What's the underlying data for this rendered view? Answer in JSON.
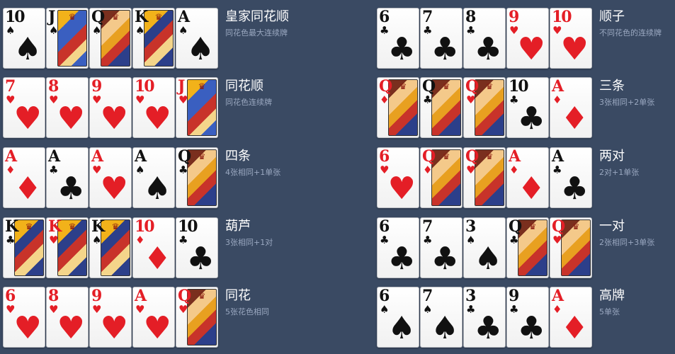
{
  "left": [
    {
      "title": "皇家同花顺",
      "subtitle": "同花色最大连续牌",
      "cards": [
        {
          "rank": "10",
          "suit": "♠",
          "color": "black"
        },
        {
          "rank": "J",
          "suit": "♠",
          "color": "black",
          "face": "j"
        },
        {
          "rank": "Q",
          "suit": "♠",
          "color": "black",
          "face": "q"
        },
        {
          "rank": "K",
          "suit": "♠",
          "color": "black",
          "face": "k"
        },
        {
          "rank": "A",
          "suit": "♠",
          "color": "black"
        }
      ]
    },
    {
      "title": "同花顺",
      "subtitle": "同花色连续牌",
      "cards": [
        {
          "rank": "7",
          "suit": "♥",
          "color": "red"
        },
        {
          "rank": "8",
          "suit": "♥",
          "color": "red"
        },
        {
          "rank": "9",
          "suit": "♥",
          "color": "red"
        },
        {
          "rank": "10",
          "suit": "♥",
          "color": "red"
        },
        {
          "rank": "J",
          "suit": "♥",
          "color": "red",
          "face": "j"
        }
      ]
    },
    {
      "title": "四条",
      "subtitle": "4张相同+1单张",
      "cards": [
        {
          "rank": "A",
          "suit": "♦",
          "color": "red"
        },
        {
          "rank": "A",
          "suit": "♣",
          "color": "black"
        },
        {
          "rank": "A",
          "suit": "♥",
          "color": "red"
        },
        {
          "rank": "A",
          "suit": "♠",
          "color": "black"
        },
        {
          "rank": "Q",
          "suit": "♣",
          "color": "black",
          "face": "q"
        }
      ]
    },
    {
      "title": "葫芦",
      "subtitle": "3张相同+1对",
      "cards": [
        {
          "rank": "K",
          "suit": "♣",
          "color": "black",
          "face": "k"
        },
        {
          "rank": "K",
          "suit": "♥",
          "color": "red",
          "face": "k"
        },
        {
          "rank": "K",
          "suit": "♠",
          "color": "black",
          "face": "k"
        },
        {
          "rank": "10",
          "suit": "♦",
          "color": "red"
        },
        {
          "rank": "10",
          "suit": "♣",
          "color": "black"
        }
      ]
    },
    {
      "title": "同花",
      "subtitle": "5张花色相同",
      "cards": [
        {
          "rank": "6",
          "suit": "♥",
          "color": "red"
        },
        {
          "rank": "8",
          "suit": "♥",
          "color": "red"
        },
        {
          "rank": "9",
          "suit": "♥",
          "color": "red"
        },
        {
          "rank": "A",
          "suit": "♥",
          "color": "red"
        },
        {
          "rank": "Q",
          "suit": "♥",
          "color": "red",
          "face": "q"
        }
      ]
    }
  ],
  "right": [
    {
      "title": "顺子",
      "subtitle": "不同花色的连续牌",
      "cards": [
        {
          "rank": "6",
          "suit": "♣",
          "color": "black"
        },
        {
          "rank": "7",
          "suit": "♣",
          "color": "black"
        },
        {
          "rank": "8",
          "suit": "♣",
          "color": "black"
        },
        {
          "rank": "9",
          "suit": "♥",
          "color": "red"
        },
        {
          "rank": "10",
          "suit": "♥",
          "color": "red"
        }
      ]
    },
    {
      "title": "三条",
      "subtitle": "3张相同+2单张",
      "cards": [
        {
          "rank": "Q",
          "suit": "♦",
          "color": "red",
          "face": "q"
        },
        {
          "rank": "Q",
          "suit": "♣",
          "color": "black",
          "face": "q"
        },
        {
          "rank": "Q",
          "suit": "♥",
          "color": "red",
          "face": "q"
        },
        {
          "rank": "10",
          "suit": "♣",
          "color": "black"
        },
        {
          "rank": "A",
          "suit": "♦",
          "color": "red"
        }
      ]
    },
    {
      "title": "两对",
      "subtitle": "2对+1单张",
      "cards": [
        {
          "rank": "6",
          "suit": "♥",
          "color": "red"
        },
        {
          "rank": "Q",
          "suit": "♦",
          "color": "red",
          "face": "q"
        },
        {
          "rank": "Q",
          "suit": "♥",
          "color": "red",
          "face": "q"
        },
        {
          "rank": "A",
          "suit": "♦",
          "color": "red"
        },
        {
          "rank": "A",
          "suit": "♣",
          "color": "black"
        }
      ]
    },
    {
      "title": "一对",
      "subtitle": "2张相同+3单张",
      "cards": [
        {
          "rank": "6",
          "suit": "♣",
          "color": "black"
        },
        {
          "rank": "7",
          "suit": "♣",
          "color": "black"
        },
        {
          "rank": "3",
          "suit": "♠",
          "color": "black"
        },
        {
          "rank": "Q",
          "suit": "♣",
          "color": "black",
          "face": "q"
        },
        {
          "rank": "Q",
          "suit": "♥",
          "color": "red",
          "face": "q"
        }
      ]
    },
    {
      "title": "高牌",
      "subtitle": "5单张",
      "cards": [
        {
          "rank": "6",
          "suit": "♠",
          "color": "black"
        },
        {
          "rank": "7",
          "suit": "♠",
          "color": "black"
        },
        {
          "rank": "3",
          "suit": "♣",
          "color": "black"
        },
        {
          "rank": "9",
          "suit": "♣",
          "color": "black"
        },
        {
          "rank": "A",
          "suit": "♦",
          "color": "red"
        }
      ]
    }
  ]
}
